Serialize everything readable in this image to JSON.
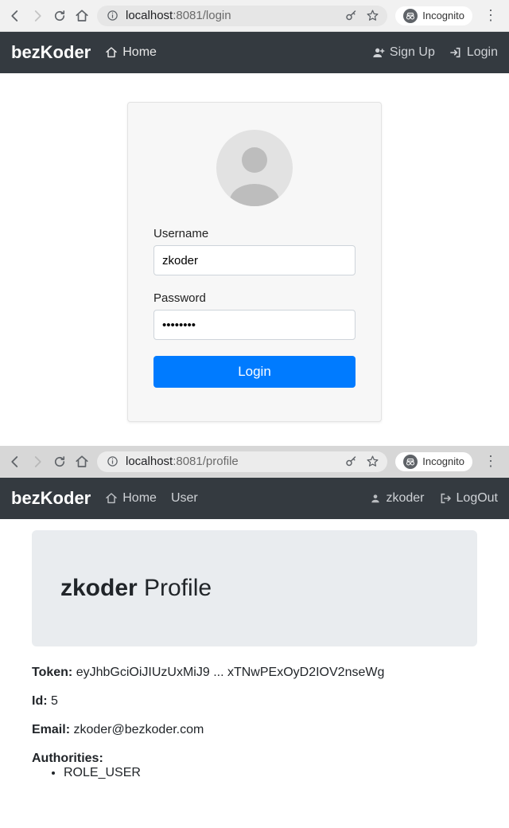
{
  "browser1": {
    "host": "localhost",
    "port_path": ":8081/login",
    "incognito_label": "Incognito"
  },
  "nav1": {
    "brand": "bezKoder",
    "home": "Home",
    "signup": "Sign Up",
    "login": "Login"
  },
  "login_form": {
    "username_label": "Username",
    "username_value": "zkoder",
    "password_label": "Password",
    "password_value": "••••••••",
    "submit": "Login"
  },
  "browser2": {
    "host": "localhost",
    "port_path": ":8081/profile",
    "incognito_label": "Incognito"
  },
  "nav2": {
    "brand": "bezKoder",
    "home": "Home",
    "user": "User",
    "username": "zkoder",
    "logout": "LogOut"
  },
  "profile": {
    "title_user": "zkoder",
    "title_word": " Profile",
    "token_label": "Token:",
    "token_value": "eyJhbGciOiJIUzUxMiJ9 ... xTNwPExOyD2IOV2nseWg",
    "id_label": "Id:",
    "id_value": "5",
    "email_label": "Email:",
    "email_value": "zkoder@bezkoder.com",
    "auth_label": "Authorities:",
    "auth_items": [
      "ROLE_USER"
    ]
  }
}
